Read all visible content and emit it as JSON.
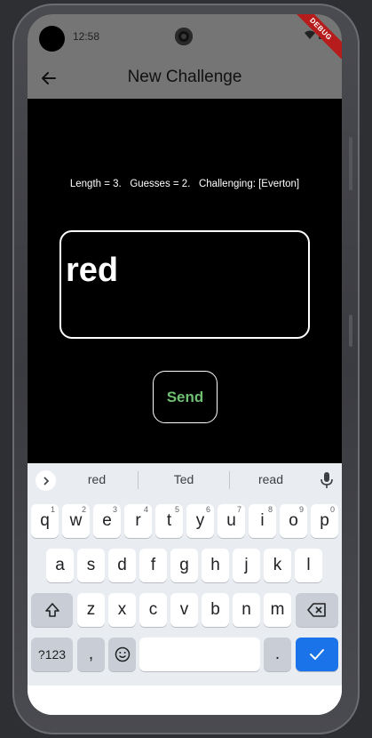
{
  "status_bar": {
    "time": "12:58"
  },
  "debug_banner": "DEBUG",
  "app_bar": {
    "title": "New Challenge"
  },
  "challenge": {
    "info": "Length = 3.   Guesses = 2.   Challenging: [Everton]",
    "word": "red",
    "send_label": "Send"
  },
  "keyboard": {
    "suggestions": [
      "red",
      "Ted",
      "read"
    ],
    "row1": [
      {
        "key": "q",
        "hint": "1"
      },
      {
        "key": "w",
        "hint": "2"
      },
      {
        "key": "e",
        "hint": "3"
      },
      {
        "key": "r",
        "hint": "4"
      },
      {
        "key": "t",
        "hint": "5"
      },
      {
        "key": "y",
        "hint": "6"
      },
      {
        "key": "u",
        "hint": "7"
      },
      {
        "key": "i",
        "hint": "8"
      },
      {
        "key": "o",
        "hint": "9"
      },
      {
        "key": "p",
        "hint": "0"
      }
    ],
    "row2": [
      "a",
      "s",
      "d",
      "f",
      "g",
      "h",
      "j",
      "k",
      "l"
    ],
    "row3": [
      "z",
      "x",
      "c",
      "v",
      "b",
      "n",
      "m"
    ],
    "symbols_label": "?123",
    "comma": ",",
    "period": "."
  },
  "icons": {
    "back": "arrow-left-icon",
    "chevron": "chevron-right-icon",
    "mic": "microphone-icon",
    "shift": "shift-icon",
    "backspace": "backspace-icon",
    "emoji": "emoji-icon",
    "enter": "checkmark-icon"
  },
  "colors": {
    "app_bar": "#757575",
    "send_text": "#6fbf73",
    "enter_key": "#1a73e8",
    "debug": "#b71c1c"
  }
}
